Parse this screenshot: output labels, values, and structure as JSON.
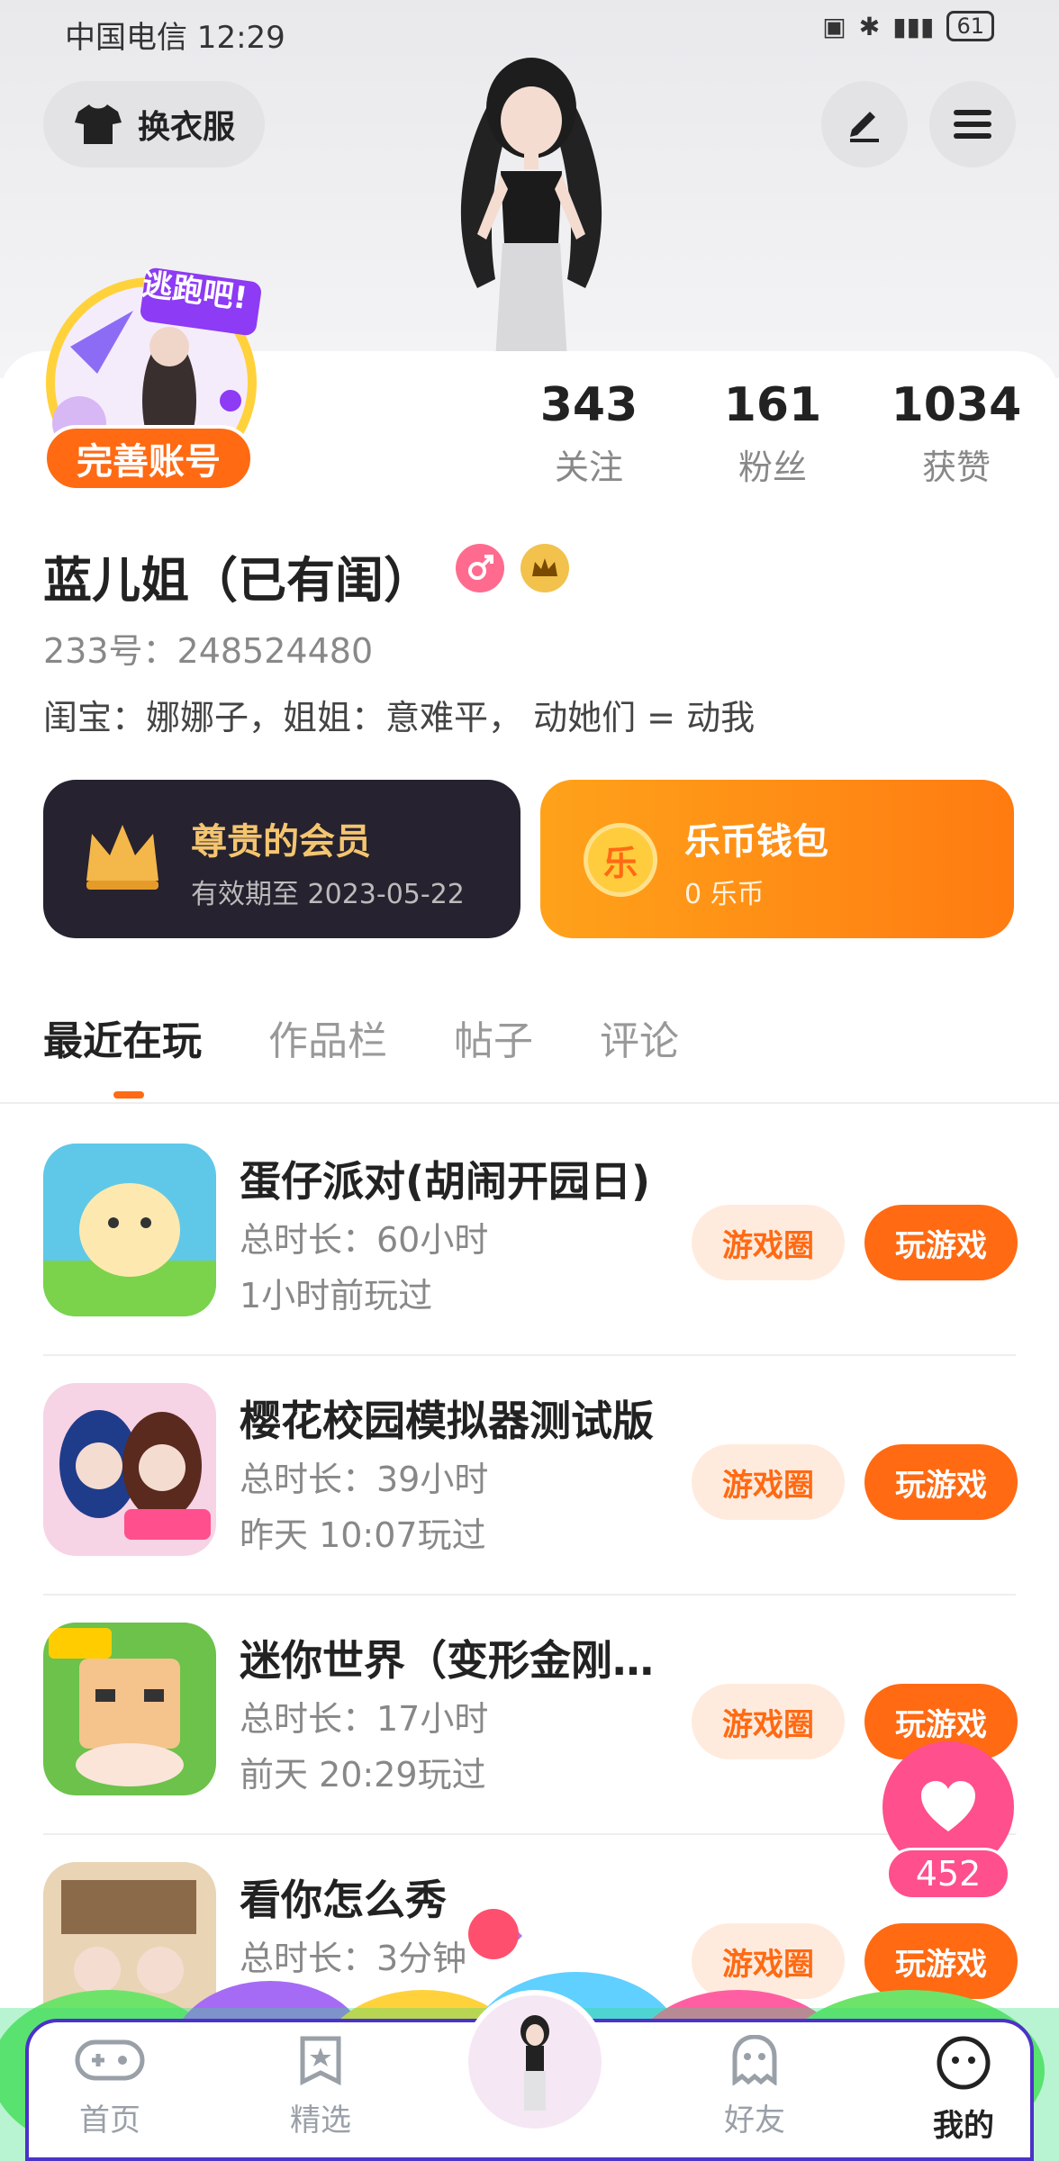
{
  "status": {
    "carrier_time": "中国电信 12:29",
    "battery": "61"
  },
  "header": {
    "wardrobe_label": "换衣服",
    "edit_icon": "pencil-icon",
    "menu_icon": "menu-icon"
  },
  "profile": {
    "badge_text": "逃跑吧!",
    "complete_label": "完善账号",
    "stats": [
      {
        "value": "343",
        "label": "关注"
      },
      {
        "value": "161",
        "label": "粉丝"
      },
      {
        "value": "1034",
        "label": "获赞"
      }
    ],
    "name": "蓝儿姐（已有闺）",
    "uid": "233号：248524480",
    "bio": "闺宝：娜娜子，姐姐：意难平， 动她们 = 动我"
  },
  "member_card": {
    "title": "尊贵的会员",
    "subtitle": "有效期至 2023-05-22"
  },
  "wallet_card": {
    "title": "乐币钱包",
    "subtitle": "0 乐币",
    "coin_glyph": "乐"
  },
  "tabs": [
    {
      "label": "最近在玩",
      "active": true
    },
    {
      "label": "作品栏",
      "active": false
    },
    {
      "label": "帖子",
      "active": false
    },
    {
      "label": "评论",
      "active": false
    }
  ],
  "games": [
    {
      "title": "蛋仔派对(胡闹开园日)",
      "duration": "总时长：60小时",
      "last_played": "1小时前玩过",
      "circle_label": "游戏圈",
      "play_label": "玩游戏",
      "icon_color": "#5fc8e8"
    },
    {
      "title": "樱花校园模拟器测试版",
      "duration": "总时长：39小时",
      "last_played": "昨天 10:07玩过",
      "circle_label": "游戏圈",
      "play_label": "玩游戏",
      "icon_color": "#f4a6c8"
    },
    {
      "title": "迷你世界（变形金刚…",
      "duration": "总时长：17小时",
      "last_played": "前天 20:29玩过",
      "circle_label": "游戏圈",
      "play_label": "玩游戏",
      "icon_color": "#6cc24a"
    },
    {
      "title": "看你怎么秀",
      "duration": "总时长：3分钟",
      "last_played": "",
      "circle_label": "游戏圈",
      "play_label": "玩游戏",
      "icon_color": "#e9d4b5"
    }
  ],
  "like": {
    "count": "452"
  },
  "nav": [
    {
      "label": "首页",
      "icon": "gamepad-icon",
      "active": false
    },
    {
      "label": "精选",
      "icon": "star-bookmark-icon",
      "active": false
    },
    {
      "label": "好友",
      "icon": "ghost-icon",
      "active": false
    },
    {
      "label": "我的",
      "icon": "smiley-icon",
      "active": true
    }
  ],
  "colors": {
    "accent": "#ff6a13",
    "member_bg": "#26222f",
    "gold": "#f4c56f",
    "like": "#ff4f8c",
    "nav_border": "#4b32c8"
  }
}
